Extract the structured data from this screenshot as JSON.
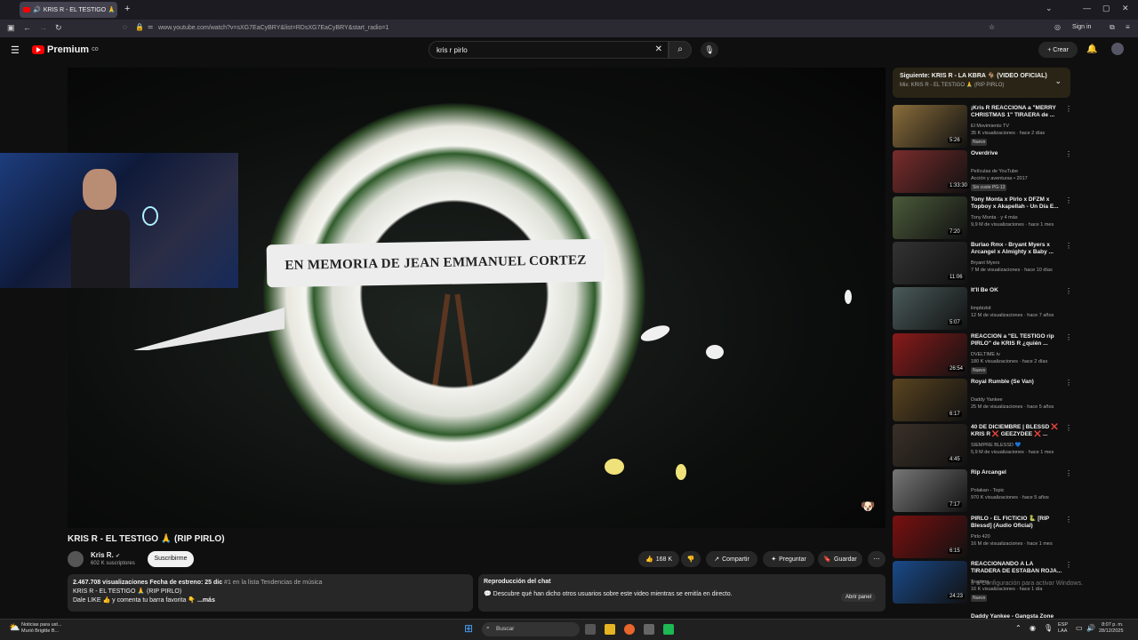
{
  "browser": {
    "tab_title": "KRIS R - EL TESTIGO 🙏 (RI",
    "url": "www.youtube.com/watch?v=sXG7EaCyBRY&list=RDsXG7EaCyBRY&start_radio=1",
    "sign_in": "Sign in"
  },
  "header": {
    "logo": "Premium",
    "logo_sup": "CO",
    "search_value": "kris r pirlo",
    "create": "Crear"
  },
  "player": {
    "ribbon_text": "EN MEMORIA DE JEAN EMMANUEL CORTEZ"
  },
  "video": {
    "title": "KRIS R - EL TESTIGO 🙏 (RIP PIRLO)",
    "channel": "Kris R.",
    "subscribers": "602 K suscriptores",
    "subscribe": "Suscribirme",
    "likes": "168 K",
    "share": "Compartir",
    "ask": "Preguntar",
    "save": "Guardar"
  },
  "description": {
    "stats": "2.467.708 visualizaciones  Fecha de estreno: 25 dic",
    "trend": "#1 en la lista Tendencias de música",
    "line2": "KRIS R - EL TESTIGO 🙏 (RIP PIRLO)",
    "line3": "Dale LIKE 👍 y comenta tu barra favorita 👇",
    "more": "...más"
  },
  "chat": {
    "title": "Reproducción del chat",
    "text": "Descubre qué han dicho otros usuarios sobre este video mientras se emitía en directo.",
    "open": "Abrir panel"
  },
  "next": {
    "label": "Siguiente: KRIS R - LA KBRA 🐐 (VIDEO OFICIAL)",
    "mix": "Mix: KRIS R - EL TESTIGO 🙏 (RIP PIRLO)"
  },
  "recs": [
    {
      "title": "¡Kris R REACCIONA a \"MERRY CHRISTMAS 1\" TIRAERA de ...",
      "channel": "El Movimiento TV",
      "meta": "35 K visualizaciones · hace 2 días",
      "badge": "Nuevo",
      "dur": "5:26",
      "color": "#8a6d3b"
    },
    {
      "title": "Overdrive",
      "channel": "Películas de YouTube",
      "meta": "Acción y aventuras • 2017",
      "badge": "Sin coste  PG-13",
      "dur": "1:33:30",
      "color": "#7a2c2c"
    },
    {
      "title": "Tony Monta x Pirlo x DFZM x Topboy x Akapellah - Un Día E...",
      "channel": "Tony Monta · y 4 más",
      "meta": "9,9 M de visualizaciones · hace 1 mes",
      "badge": "",
      "dur": "7:20",
      "color": "#4b5a3a"
    },
    {
      "title": "Burlao Rmx - Bryant Myers x Arcangel x Almighty x Baby ...",
      "channel": "Bryant Myers",
      "meta": "7 M de visualizaciones · hace 10 días",
      "badge": "",
      "dur": "11:06",
      "color": "#333"
    },
    {
      "title": "It'll Be OK",
      "channel": "limpbizkit",
      "meta": "12 M de visualizaciones · hace 7 años",
      "badge": "",
      "dur": "5:07",
      "color": "#4a5a5a"
    },
    {
      "title": "REACCION a \"EL TESTIGO rip PIRLO\" de KRIS R ¿quién ...",
      "channel": "DVELTIME tv",
      "meta": "180 K visualizaciones · hace 2 días",
      "badge": "Nuevo",
      "dur": "26:54",
      "color": "#8a1a1a"
    },
    {
      "title": "Royal Rumble (Se Van)",
      "channel": "Daddy Yankee",
      "meta": "25 M de visualizaciones · hace 5 años",
      "badge": "",
      "dur": "6:17",
      "color": "#5a4420"
    },
    {
      "title": "40 DE DICIEMBRE | BLESSD ❌ KRIS R ❌ GEEZYDEE ❌ ...",
      "channel": "SIEMPRE BLESSD 💙",
      "meta": "5,9 M de visualizaciones · hace 1 mes",
      "badge": "",
      "dur": "4:45",
      "color": "#3a3028"
    },
    {
      "title": "Rip Arcangel",
      "channel": "Polakan - Topic",
      "meta": "970 K visualizaciones · hace 5 años",
      "badge": "",
      "dur": "7:17",
      "color": "#777"
    },
    {
      "title": "PIRLO - EL FICTICIO 🐍 [RIP Blessd] (Audio Oficial)",
      "channel": "Pirlo 420",
      "meta": "16 M de visualizaciones · hace 1 mes",
      "badge": "",
      "dur": "6:15",
      "color": "#7a1010"
    },
    {
      "title": "REACCIONANDO A LA TIRADERA DE ESTABAN ROJA...",
      "channel": "Traphog",
      "meta": "16 K visualizaciones · hace 1 día",
      "badge": "Nuevo",
      "dur": "24:23",
      "color": "#1a4a8a"
    }
  ],
  "partial_rec": "Daddy Yankee - Gangsta Zone",
  "activation": "Ir a Configuración para activar Windows.",
  "taskbar": {
    "news1": "Noticias para ust...",
    "news2": "Murió Brigitte B...",
    "search": "Buscar",
    "lang1": "ESP",
    "lang2": "LAA",
    "time": "8:07 p. m.",
    "date": "28/12/2025"
  },
  "colors": {
    "accent": "#ff0000",
    "background": "#0f0f0f",
    "surface": "#272727"
  }
}
